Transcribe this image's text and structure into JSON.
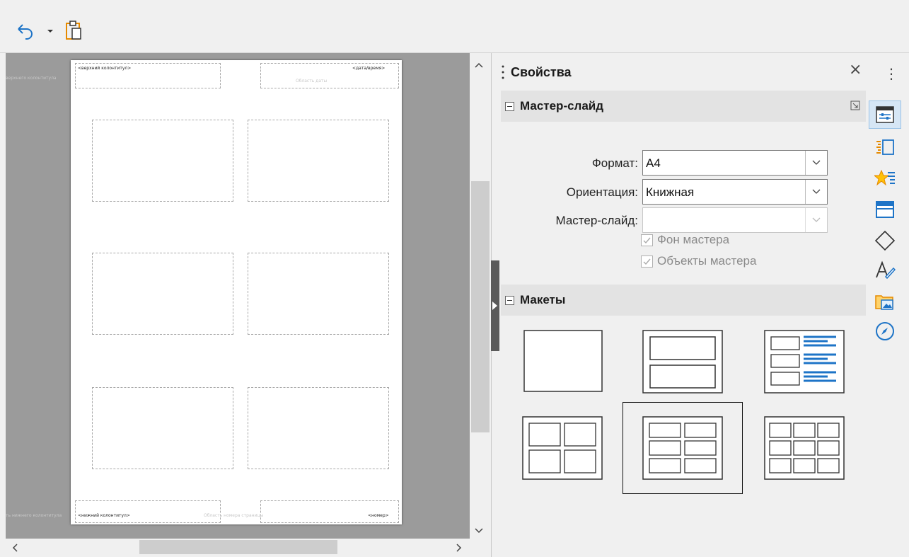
{
  "toolbar": {
    "undo_icon": "undo-icon",
    "dropdown_icon": "chevron-down-icon",
    "paste_icon": "paste-icon"
  },
  "document": {
    "header_left": "<верхний колонтитул>",
    "header_right": "<дата/время>",
    "date_area": "Область даты",
    "header_ghost": "верхнего колонтитула",
    "footer_left": "<нижний колонтитул>",
    "footer_right": "<номер>",
    "page_number_area": "Область номера страницы",
    "footer_ghost": "ть нижнего колонтитула"
  },
  "sidebar": {
    "title": "Свойства",
    "close": "×",
    "menu": "⋮",
    "master_section": {
      "title": "Мастер-слайд",
      "format_label": "Формат:",
      "format_value": "A4",
      "orientation_label": "Ориентация:",
      "orientation_value": "Книжная",
      "master_label": "Мастер-слайд:",
      "master_value": "",
      "bg_checkbox": "Фон мастера",
      "objects_checkbox": "Объекты мастера"
    },
    "layouts_section": {
      "title": "Макеты",
      "selected_index": 4
    }
  },
  "rail": {
    "icons": [
      "properties-icon",
      "slide-transition-icon",
      "animation-icon",
      "master-slides-icon",
      "shapes-icon",
      "styles-icon",
      "gallery-icon",
      "navigator-icon"
    ]
  },
  "colors": {
    "accent": "#1e74c7",
    "doc_background": "#9b9b9b",
    "section_header": "#e3e3e3"
  }
}
